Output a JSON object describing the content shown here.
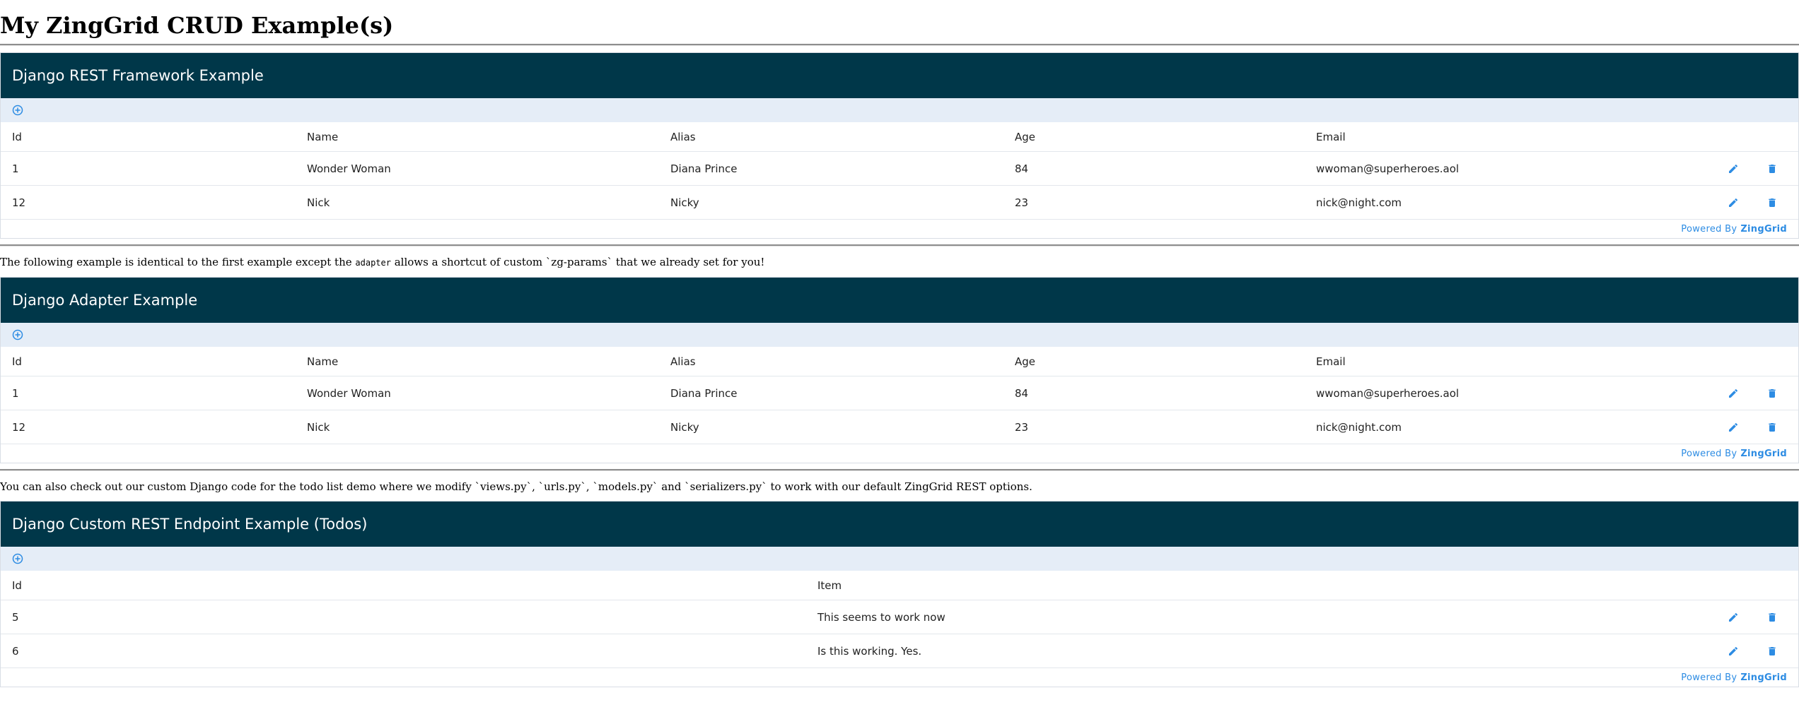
{
  "page": {
    "title": "My ZingGrid CRUD Example(s)",
    "note1": {
      "before": "The following example is identical to the first example except the ",
      "code": "adapter",
      "after": " allows a shortcut of custom `zg-params` that we already set for you!"
    },
    "note2": "You can also check out our custom Django code for the todo list demo where we modify `views.py`, `urls.py`, `models.py` and `serializers.py` to work with our default ZingGrid REST options."
  },
  "colors": {
    "caption_bg": "#003749",
    "controls_bg": "#e5edf7",
    "icon_blue": "#2d8ce3"
  },
  "grids": {
    "rest": {
      "caption": "Django REST Framework Example",
      "columns": [
        "Id",
        "Name",
        "Alias",
        "Age",
        "Email"
      ],
      "rows": [
        [
          "1",
          "Wonder Woman",
          "Diana Prince",
          "84",
          "wwoman@superheroes.aol"
        ],
        [
          "12",
          "Nick",
          "Nicky",
          "23",
          "nick@night.com"
        ]
      ],
      "footer_prefix": "Powered By",
      "footer_brand": "ZingGrid"
    },
    "adapter": {
      "caption": "Django Adapter Example",
      "columns": [
        "Id",
        "Name",
        "Alias",
        "Age",
        "Email"
      ],
      "rows": [
        [
          "1",
          "Wonder Woman",
          "Diana Prince",
          "84",
          "wwoman@superheroes.aol"
        ],
        [
          "12",
          "Nick",
          "Nicky",
          "23",
          "nick@night.com"
        ]
      ],
      "footer_prefix": "Powered By",
      "footer_brand": "ZingGrid"
    },
    "todos": {
      "caption": "Django Custom REST Endpoint Example (Todos)",
      "columns": [
        "Id",
        "Item"
      ],
      "rows": [
        [
          "5",
          "This seems to work now"
        ],
        [
          "6",
          "Is this working. Yes."
        ]
      ],
      "footer_prefix": "Powered By",
      "footer_brand": "ZingGrid"
    }
  }
}
